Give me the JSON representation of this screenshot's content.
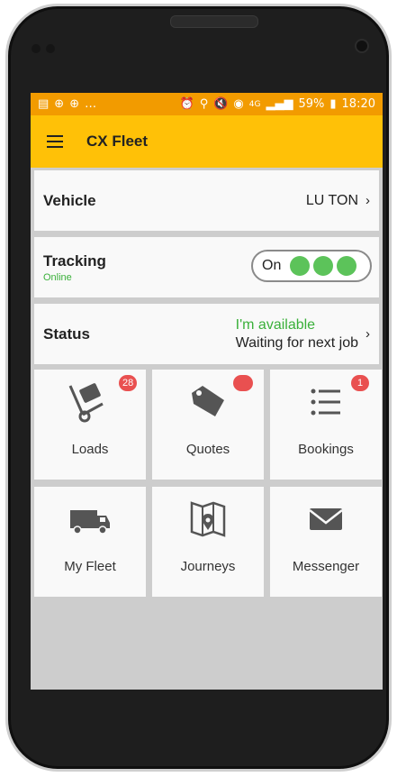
{
  "status_bar": {
    "left_icons": [
      "notification-icon",
      "circle-icon",
      "circle-icon",
      "more-icon"
    ],
    "right_icons": [
      "alarm-icon",
      "location-icon",
      "mute-icon",
      "data-icon"
    ],
    "network": "4G",
    "battery": "59%",
    "time": "18:20"
  },
  "app_bar": {
    "title": "CX Fleet"
  },
  "vehicle": {
    "label": "Vehicle",
    "value": "LU TON",
    "chevron": "›"
  },
  "tracking": {
    "label": "Tracking",
    "sublabel": "Online",
    "toggle_text": "On"
  },
  "status": {
    "label": "Status",
    "line1": "I'm available",
    "line2": "Waiting for next job",
    "chevron": "›"
  },
  "tiles": [
    {
      "label": "Loads",
      "icon": "hand-truck-icon",
      "badge": "28"
    },
    {
      "label": "Quotes",
      "icon": "tag-icon",
      "badge": ""
    },
    {
      "label": "Bookings",
      "icon": "list-icon",
      "badge": "1"
    },
    {
      "label": "My Fleet",
      "icon": "van-icon",
      "badge": null
    },
    {
      "label": "Journeys",
      "icon": "map-pin-icon",
      "badge": null
    },
    {
      "label": "Messenger",
      "icon": "envelope-icon",
      "badge": null
    }
  ],
  "colors": {
    "status_bar": "#f29b00",
    "app_bar": "#ffc107",
    "online_green": "#5cc35a",
    "badge_red": "#e95050"
  }
}
